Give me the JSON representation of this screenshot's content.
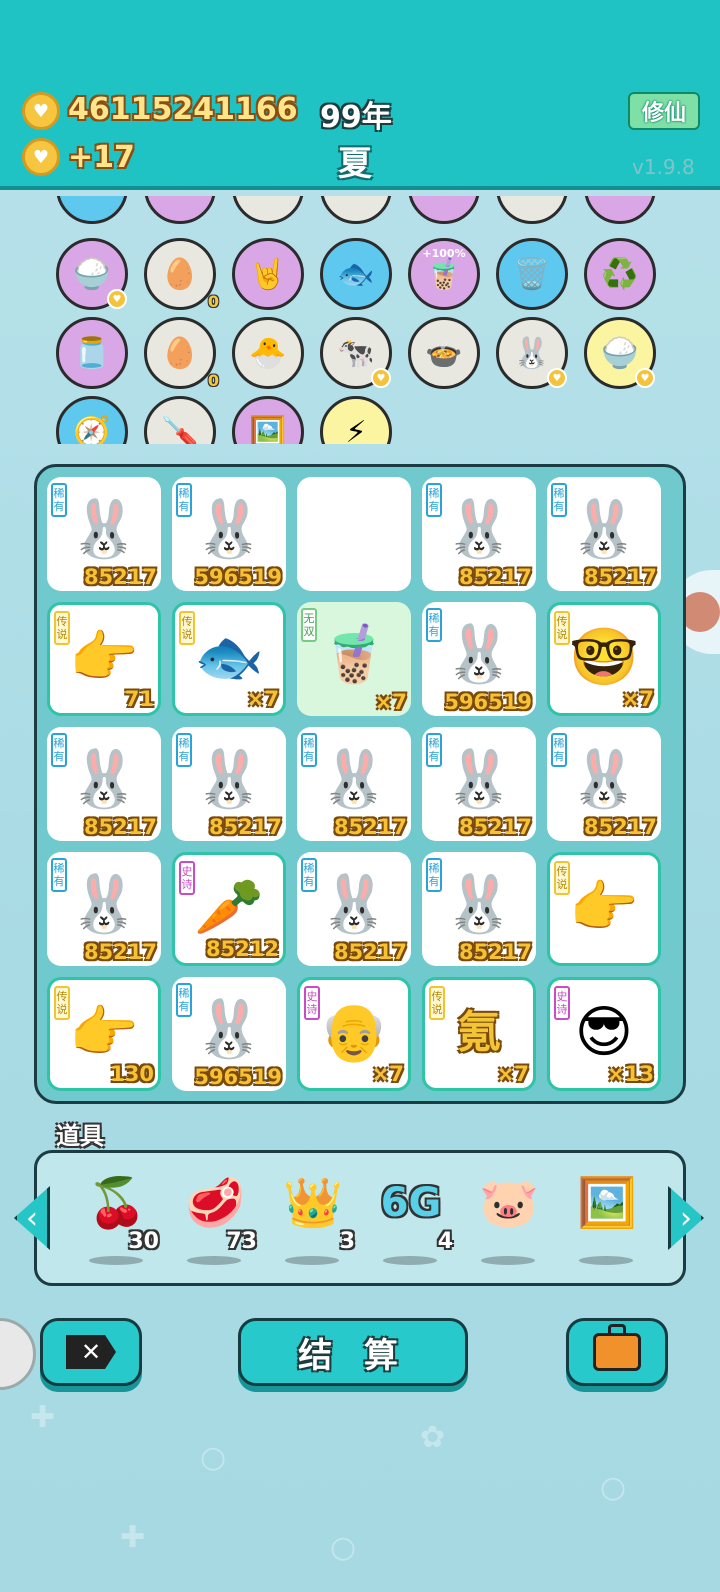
{
  "header": {
    "money": "46115241166",
    "income": "+17",
    "year": "99年",
    "season": "夏",
    "cultivate_label": "修仙",
    "version": "v1.9.8"
  },
  "shop": {
    "rows": [
      [
        {
          "icon": "🍚",
          "bg": "#d9a6e6",
          "badge": "heart"
        },
        {
          "icon": "🥚",
          "bg": "#e8e8e0",
          "count": "0"
        },
        {
          "icon": "🤘",
          "bg": "#d9a6e6"
        },
        {
          "icon": "🐟",
          "bg": "#5ec8ef"
        },
        {
          "icon": "🧋",
          "bg": "#d9a6e6",
          "label": "+100%"
        },
        {
          "icon": "🗑️",
          "bg": "#5ec8ef"
        },
        {
          "icon": "♻️",
          "bg": "#d9a6e6"
        }
      ],
      [
        {
          "icon": "🫙",
          "bg": "#d9a6e6"
        },
        {
          "icon": "🥚",
          "bg": "#e8e8e0",
          "count": "0"
        },
        {
          "icon": "🐣",
          "bg": "#e8e8e0"
        },
        {
          "icon": "🐄",
          "bg": "#e8e8e0",
          "badge": "heart"
        },
        {
          "icon": "🍲",
          "bg": "#e8e8e0"
        },
        {
          "icon": "🐰",
          "bg": "#e8e8e0",
          "badge": "heart"
        },
        {
          "icon": "🍚",
          "bg": "#fbf4a0",
          "badge": "heart"
        }
      ],
      [
        {
          "icon": "🧭",
          "bg": "#5ec8ef"
        },
        {
          "icon": "🪛",
          "bg": "#e8e8e0"
        },
        {
          "icon": "🖼️",
          "bg": "#d9a6e6"
        },
        {
          "icon": "⚡",
          "bg": "#fbf4a0"
        }
      ]
    ]
  },
  "board": {
    "cells": [
      {
        "tag": "稀有",
        "type": "rare",
        "icon": "🐰",
        "num": "85217"
      },
      {
        "tag": "稀有",
        "type": "rare",
        "icon": "🐰",
        "num": "596519"
      },
      {
        "tag": "",
        "type": "empty",
        "icon": "",
        "num": ""
      },
      {
        "tag": "稀有",
        "type": "rare",
        "icon": "🐰",
        "num": "85217"
      },
      {
        "tag": "稀有",
        "type": "rare",
        "icon": "🐰",
        "num": "85217"
      },
      {
        "tag": "传说",
        "type": "leg",
        "icon": "👉",
        "num": "71"
      },
      {
        "tag": "传说",
        "type": "leg",
        "icon": "🐟",
        "num": "×7"
      },
      {
        "tag": "无双",
        "type": "none",
        "icon": "🧋",
        "num": "×7"
      },
      {
        "tag": "稀有",
        "type": "rare",
        "icon": "🐰",
        "num": "596519"
      },
      {
        "tag": "传说",
        "type": "leg",
        "icon": "🤓",
        "num": "×7"
      },
      {
        "tag": "稀有",
        "type": "rare",
        "icon": "🐰",
        "num": "85217"
      },
      {
        "tag": "稀有",
        "type": "rare",
        "icon": "🐰",
        "num": "85217"
      },
      {
        "tag": "稀有",
        "type": "rare",
        "icon": "🐰",
        "num": "85217"
      },
      {
        "tag": "稀有",
        "type": "rare",
        "icon": "🐰",
        "num": "85217"
      },
      {
        "tag": "稀有",
        "type": "rare",
        "icon": "🐰",
        "num": "85217"
      },
      {
        "tag": "稀有",
        "type": "rare",
        "icon": "🐰",
        "num": "85217"
      },
      {
        "tag": "史诗",
        "type": "epic",
        "icon": "🥕",
        "num": "85212"
      },
      {
        "tag": "稀有",
        "type": "rare",
        "icon": "🐰",
        "num": "85217"
      },
      {
        "tag": "稀有",
        "type": "rare",
        "icon": "🐰",
        "num": "85217"
      },
      {
        "tag": "传说",
        "type": "leg",
        "icon": "👉",
        "num": ""
      },
      {
        "tag": "传说",
        "type": "leg",
        "icon": "👉",
        "num": "130"
      },
      {
        "tag": "稀有",
        "type": "rare",
        "icon": "🐰",
        "num": "596519"
      },
      {
        "tag": "史诗",
        "type": "epic",
        "icon": "👴",
        "num": "×7"
      },
      {
        "tag": "传说",
        "type": "leg",
        "icon": "氪",
        "num": "×7"
      },
      {
        "tag": "史诗",
        "type": "epic",
        "icon": "😎",
        "num": "×13"
      }
    ]
  },
  "props": {
    "title": "道具",
    "items": [
      {
        "name": "lychee",
        "icon": "🍒",
        "count": "30"
      },
      {
        "name": "liver",
        "icon": "🥩",
        "count": "73"
      },
      {
        "name": "crown",
        "icon": "👑",
        "count": "3"
      },
      {
        "name": "6g",
        "icon": "6G",
        "count": "4"
      },
      {
        "name": "piggy-bank",
        "icon": "🐷",
        "count": ""
      },
      {
        "name": "frame",
        "icon": "🖼️",
        "count": ""
      }
    ]
  },
  "bottom": {
    "settle_label": "结 算"
  }
}
